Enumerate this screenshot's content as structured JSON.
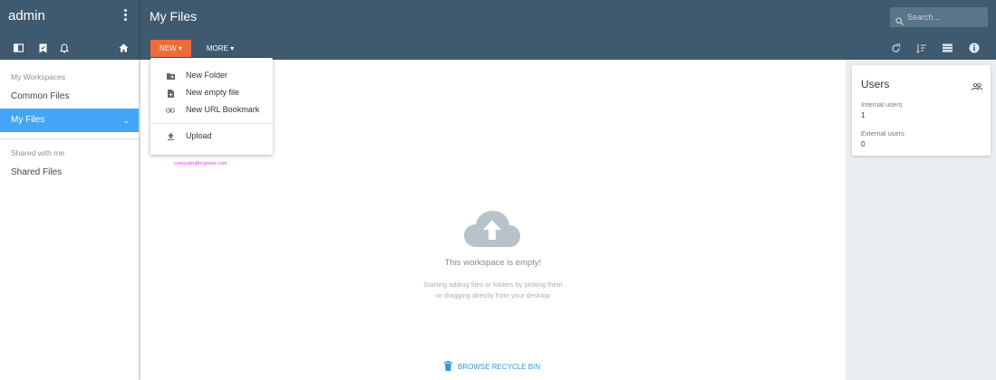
{
  "sidebar": {
    "user": "admin",
    "section_workspaces": "My Workspaces",
    "items": [
      {
        "label": "Common Files"
      },
      {
        "label": "My Files"
      }
    ],
    "section_shared": "Shared with me",
    "shared_items": [
      {
        "label": "Shared Files"
      }
    ]
  },
  "header": {
    "title": "My Files",
    "search_placeholder": "Search...",
    "new_label": "NEW",
    "more_label": "MORE"
  },
  "dropdown": {
    "items": [
      {
        "label": "New Folder",
        "icon": "folder-add-icon"
      },
      {
        "label": "New empty file",
        "icon": "file-add-icon"
      },
      {
        "label": "New URL Bookmark",
        "icon": "link-icon"
      },
      {
        "label": "Upload",
        "icon": "upload-icon"
      }
    ]
  },
  "main": {
    "watermark": "computingforgeeks.com",
    "empty_title": "This workspace is empty!",
    "empty_desc_line1": "Starting adding files or folders by picking them",
    "empty_desc_line2": "or dragging directly from your desktop",
    "recycle_label": "BROWSE RECYCLE BIN"
  },
  "users": {
    "title": "Users",
    "internal_label": "Internal users",
    "internal_value": "1",
    "external_label": "External users",
    "external_value": "0"
  },
  "colors": {
    "header_bg": "#3f5a6f",
    "accent_orange": "#ef6c3a",
    "active_blue": "#42a5f5",
    "link_blue": "#2f9bdb"
  }
}
